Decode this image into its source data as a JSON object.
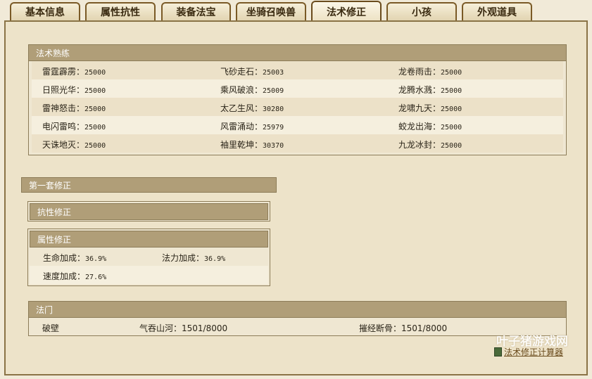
{
  "tabs": [
    {
      "label": "基本信息"
    },
    {
      "label": "属性抗性"
    },
    {
      "label": "装备法宝"
    },
    {
      "label": "坐骑召唤兽"
    },
    {
      "label": "法术修正"
    },
    {
      "label": "小孩"
    },
    {
      "label": "外观道具"
    }
  ],
  "active_tab": "法术修正",
  "skills": {
    "title": "法术熟练",
    "rows": [
      [
        {
          "name": "雷霆霹雳：",
          "val": "25000"
        },
        {
          "name": "飞砂走石：",
          "val": "25003"
        },
        {
          "name": "龙卷雨击：",
          "val": "25000"
        }
      ],
      [
        {
          "name": "日照光华：",
          "val": "25000"
        },
        {
          "name": "乘风破浪：",
          "val": "25009"
        },
        {
          "name": "龙腾水溅：",
          "val": "25000"
        }
      ],
      [
        {
          "name": "雷神怒击：",
          "val": "25000"
        },
        {
          "name": "太乙生风：",
          "val": "30280"
        },
        {
          "name": "龙啸九天：",
          "val": "25000"
        }
      ],
      [
        {
          "name": "电闪雷鸣：",
          "val": "25000"
        },
        {
          "name": "风雷涌动：",
          "val": "25979"
        },
        {
          "name": "蛟龙出海：",
          "val": "25000"
        }
      ],
      [
        {
          "name": "天诛地灭：",
          "val": "25000"
        },
        {
          "name": "袖里乾坤：",
          "val": "30370"
        },
        {
          "name": "九龙冰封：",
          "val": "25000"
        }
      ]
    ]
  },
  "set1": {
    "title": "第一套修正",
    "resist": {
      "title": "抗性修正"
    },
    "attr": {
      "title": "属性修正",
      "hp_label": "生命加成：",
      "hp_val": "36.9%",
      "mp_label": "法力加成：",
      "mp_val": "36.9%",
      "spd_label": "速度加成：",
      "spd_val": "27.6%"
    }
  },
  "school": {
    "title": "法门",
    "items": [
      {
        "text": "破壁"
      },
      {
        "text": "气吞山河：1501/8000"
      },
      {
        "text": "摧经断骨：1501/8000"
      }
    ]
  },
  "calculator_link": "法术修正计算器",
  "watermark": "叶子猪游戏网"
}
